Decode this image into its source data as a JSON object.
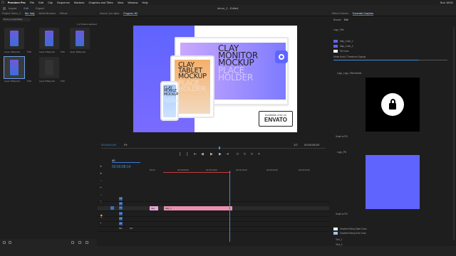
{
  "menubar": {
    "apple": "",
    "items": [
      "Premiere Pro",
      "File",
      "Edit",
      "Clip",
      "Sequence",
      "Markers",
      "Graphics and Titles",
      "View",
      "Window",
      "Help"
    ],
    "right": "Sun 18:51"
  },
  "workspace": {
    "tabs": [
      "Import",
      "Edit",
      "Export"
    ],
    "title": "demo_2 - Edited"
  },
  "project": {
    "tabs": [
      "Project: Demo_2",
      "Bin: Italy",
      "Media Browser",
      "Effects"
    ],
    "bin_name": "Demo_2.prproj/Italy",
    "count": "1 of 8 items selected",
    "items": [
      {
        "name": "Layer 1/Italy.psd",
        "dur": "5:00"
      },
      {
        "name": "Layer 2/Italy.psd",
        "dur": "5:00"
      },
      {
        "name": "Layer 3/Italy.psd",
        "dur": "5:00"
      },
      {
        "name": "Layer 4/Italy.psd",
        "dur": "5:00"
      },
      {
        "name": "Layer 5/Italy.psd",
        "dur": "5:00"
      },
      {
        "name": "Layer 6/Italy.psd",
        "dur": "5:00"
      }
    ]
  },
  "program": {
    "tabs": [
      "Source: (no clips)",
      "Program: ItD"
    ],
    "timecode_left": "00;00;00;00",
    "fit": "Fit",
    "quality": "1/2",
    "timecode_right": "00;00;08;29",
    "canvas": {
      "monitor_text": [
        "CLAY",
        "MONITOR",
        "MOCKUP"
      ],
      "monitor_light": [
        "PLACE",
        "HOLDER"
      ],
      "tablet_text": [
        "CLAY",
        "TABLET",
        "MOCKUP"
      ],
      "tablet_light": [
        "PLACE",
        "HOLDER"
      ],
      "phone_text": [
        "CLAY",
        "MOBILE",
        "MOCKUP"
      ],
      "phone_light": [
        "PLACE",
        "HOLDER"
      ],
      "envato_small": "Available only on",
      "envato_big": "ENVATO"
    }
  },
  "effects": {
    "tabs": [
      "Effect Controls",
      "Essential Graphics"
    ],
    "subtabs": [
      "Browse",
      "Edit"
    ],
    "lines": [
      "Logo_Title",
      "Italy_Color_1",
      "Italy_Color_2",
      "Fill Color",
      "White Hold // Transform Opacity",
      "Logo_Logo_Placeholder",
      "Scale to Fill",
      "Logo_Fill",
      "Scale to Fill",
      "Gradient Ramp Start Color",
      "Gradient Ramp End Color",
      "Text_1",
      "Text_2",
      "Italy_Text Color"
    ],
    "colors": {
      "c1": "#5f64ff",
      "c2": "#6a5ef0",
      "c3": "#ffffff",
      "c4": "#ffffff",
      "c5": "#9fc5f8"
    }
  },
  "timeline": {
    "tab": "ItD",
    "timecode": "00;00;08;14",
    "ruler": [
      "00;00",
      "00;00;05;00",
      "00;00;10;00",
      "00;00;15;00",
      "00;00;20;00",
      "00;00;25;00"
    ],
    "tracks": [
      "V3",
      "V2",
      "V1",
      "A1",
      "A2",
      "A3",
      "Mix"
    ],
    "clips": [
      {
        "label": "Italy",
        "color": "#e6a6d8"
      },
      {
        "label": "Italy_1",
        "color": "#e98fb0"
      }
    ],
    "mix_value": "0.0"
  }
}
